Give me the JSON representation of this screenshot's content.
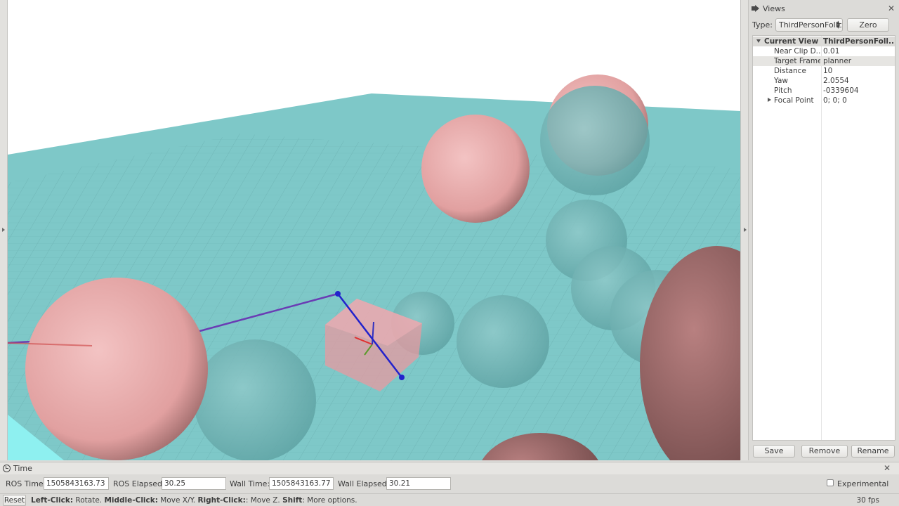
{
  "views_panel": {
    "title": "Views",
    "type_label": "Type:",
    "type_value": "ThirdPersonFollc",
    "zero_label": "Zero",
    "properties": {
      "header_key": "Current View",
      "header_value": "ThirdPersonFoll...",
      "rows": [
        {
          "key": "Near Clip D...",
          "value": "0.01"
        },
        {
          "key": "Target Frame",
          "value": "planner"
        },
        {
          "key": "Distance",
          "value": "10"
        },
        {
          "key": "Yaw",
          "value": "2.0554"
        },
        {
          "key": "Pitch",
          "value": "-0339604"
        },
        {
          "key": "Focal Point",
          "value": "0; 0; 0"
        }
      ]
    },
    "buttons": {
      "save": "Save",
      "remove": "Remove",
      "rename": "Rename"
    }
  },
  "time_panel": {
    "title": "Time",
    "ros_time_label": "ROS Time:",
    "ros_time_value": "1505843163.73",
    "ros_elapsed_label": "ROS Elapsed:",
    "ros_elapsed_value": "30.25",
    "wall_time_label": "Wall Time:",
    "wall_time_value": "1505843163.77",
    "wall_elapsed_label": "Wall Elapsed:",
    "wall_elapsed_value": "30.21",
    "experimental_label": "Experimental"
  },
  "status_bar": {
    "reset_label": "Reset",
    "help": [
      {
        "key": "Left-Click:",
        "desc": " Rotate. "
      },
      {
        "key": "Middle-Click:",
        "desc": " Move X/Y. "
      },
      {
        "key": "Right-Click:",
        "desc": ": Move Z. "
      },
      {
        "key": "Shift",
        "desc": ": More options."
      }
    ],
    "fps": "30 fps"
  },
  "colors": {
    "ground": "#7ec8c8",
    "obstacle_pink": "#e8a8a8",
    "obstacle_teal": "#6fb5b5",
    "path": "#6a3cb4",
    "trajectory": "#2222cc"
  }
}
